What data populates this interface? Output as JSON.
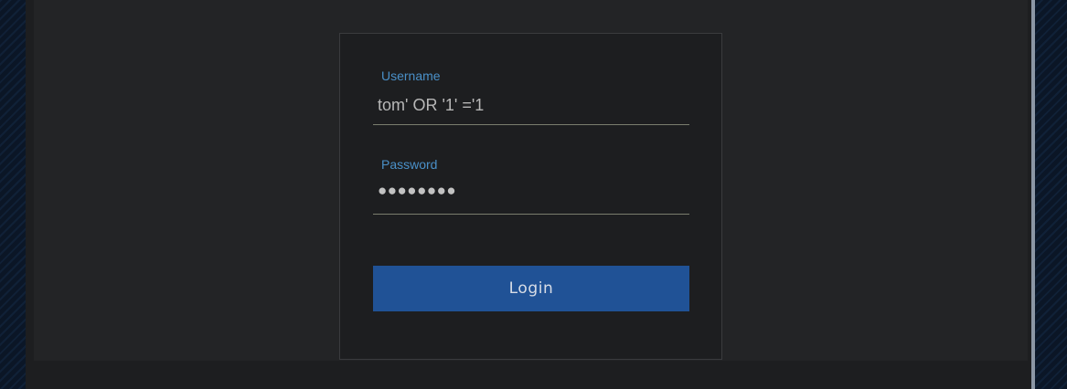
{
  "login_form": {
    "username": {
      "label": "Username",
      "value": "tom' OR '1' ='1"
    },
    "password": {
      "label": "Password",
      "value": "●●●●●●●●"
    },
    "login_button_label": "Login"
  },
  "colors": {
    "accent": "#4a90c8",
    "button": "#205296",
    "card_background": "#1d1e20",
    "panel_background": "#232426"
  }
}
